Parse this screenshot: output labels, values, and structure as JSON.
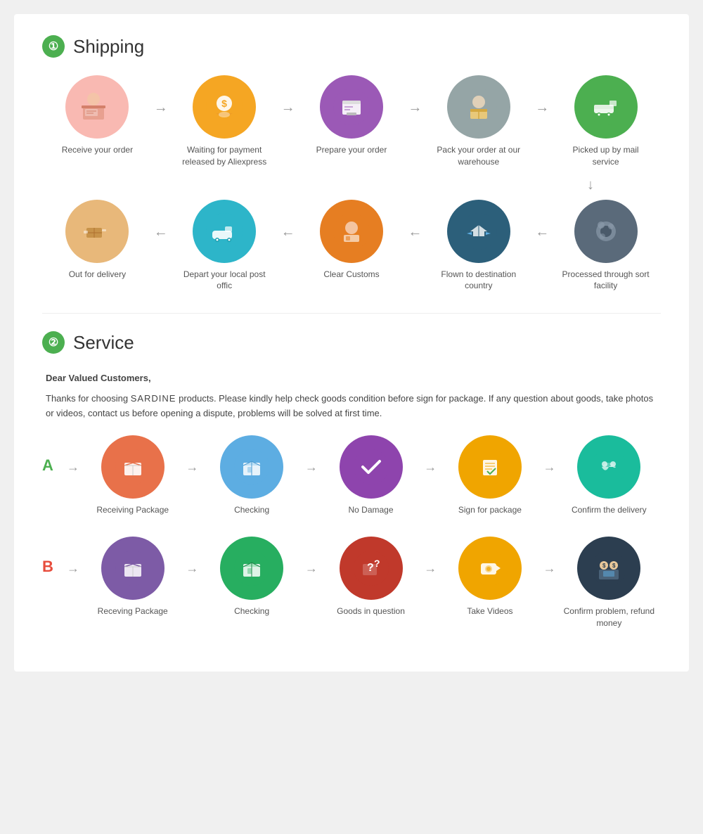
{
  "sections": {
    "shipping": {
      "number": "①",
      "title": "Shipping",
      "row1": [
        {
          "label": "Receive your order",
          "bg": "icon-pink",
          "icon": "👨‍💻"
        },
        {
          "label": "Waiting for payment released by Aliexpress",
          "bg": "icon-yellow",
          "icon": "💰"
        },
        {
          "label": "Prepare your order",
          "bg": "icon-purple",
          "icon": "🖨️"
        },
        {
          "label": "Pack your order at our warehouse",
          "bg": "icon-gray",
          "icon": "📦"
        },
        {
          "label": "Picked up by mail service",
          "bg": "icon-green",
          "icon": "🚚"
        }
      ],
      "row2": [
        {
          "label": "Out for delivery",
          "bg": "icon-tan",
          "icon": "📦"
        },
        {
          "label": "Depart your local post offic",
          "bg": "icon-teal",
          "icon": "🚐"
        },
        {
          "label": "Clear  Customs",
          "bg": "icon-orange",
          "icon": "🛃"
        },
        {
          "label": "Flown to destination country",
          "bg": "icon-navy",
          "icon": "✈️"
        },
        {
          "label": "Processed through sort facility",
          "bg": "icon-dark",
          "icon": "🌍"
        }
      ]
    },
    "service": {
      "number": "②",
      "title": "Service",
      "intro_bold": "Dear Valued Customers,",
      "intro_body": "Thanks for choosing SARDINE products. Please kindly help check goods condition before sign for package. If any question about goods, take photos or videos, contact us before opening a dispute, problems will be solved at first time.",
      "rowA": {
        "letter": "A",
        "items": [
          {
            "label": "Receiving Package",
            "bg": "icon-orange2",
            "icon": "📦"
          },
          {
            "label": "Checking",
            "bg": "icon-blue",
            "icon": "📦"
          },
          {
            "label": "No Damage",
            "bg": "icon-violet",
            "icon": "✔️"
          },
          {
            "label": "Sign for package",
            "bg": "icon-gold",
            "icon": "📋"
          },
          {
            "label": "Confirm the delivery",
            "bg": "icon-teal2",
            "icon": "🤝"
          }
        ]
      },
      "rowB": {
        "letter": "B",
        "items": [
          {
            "label": "Receving Package",
            "bg": "icon-purple2",
            "icon": "📦"
          },
          {
            "label": "Checking",
            "bg": "icon-green2",
            "icon": "📦"
          },
          {
            "label": "Goods in question",
            "bg": "icon-red",
            "icon": "❓"
          },
          {
            "label": "Take Videos",
            "bg": "icon-gold",
            "icon": "📷"
          },
          {
            "label": "Confirm problem, refund money",
            "bg": "icon-dark2",
            "icon": "💻"
          }
        ]
      }
    }
  },
  "arrows": {
    "right": "→",
    "left": "←",
    "down": "↓"
  }
}
